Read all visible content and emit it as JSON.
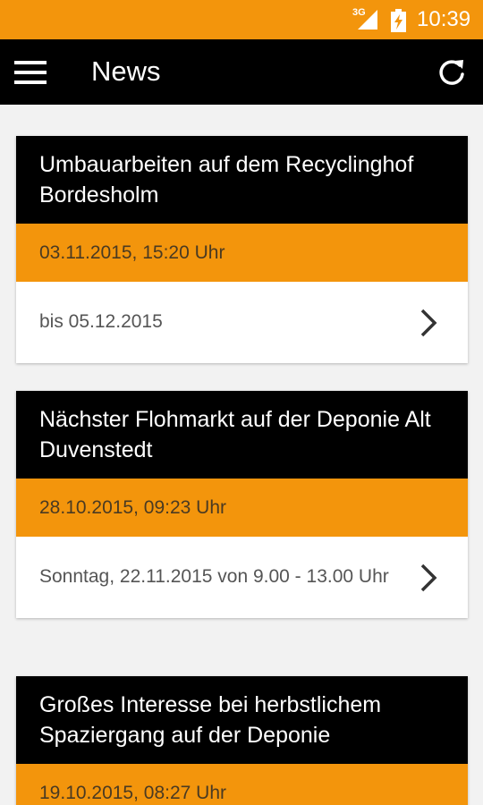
{
  "status_bar": {
    "network": "3G",
    "time": "10:39"
  },
  "app_bar": {
    "title": "News"
  },
  "news": [
    {
      "title": "Umbauarbeiten auf dem Recyclinghof Bordesholm",
      "date": "03.11.2015, 15:20 Uhr",
      "summary": "bis 05.12.2015"
    },
    {
      "title": "Nächster Flohmarkt auf der Deponie Alt Duvenstedt",
      "date": "28.10.2015, 09:23 Uhr",
      "summary": "Sonntag, 22.11.2015 von 9.00 - 13.00 Uhr"
    },
    {
      "title": "Großes Interesse bei herbstlichem Spaziergang auf der Deponie",
      "date": "19.10.2015, 08:27 Uhr",
      "summary": ""
    }
  ],
  "colors": {
    "accent": "#f3950c",
    "header": "#000000"
  }
}
